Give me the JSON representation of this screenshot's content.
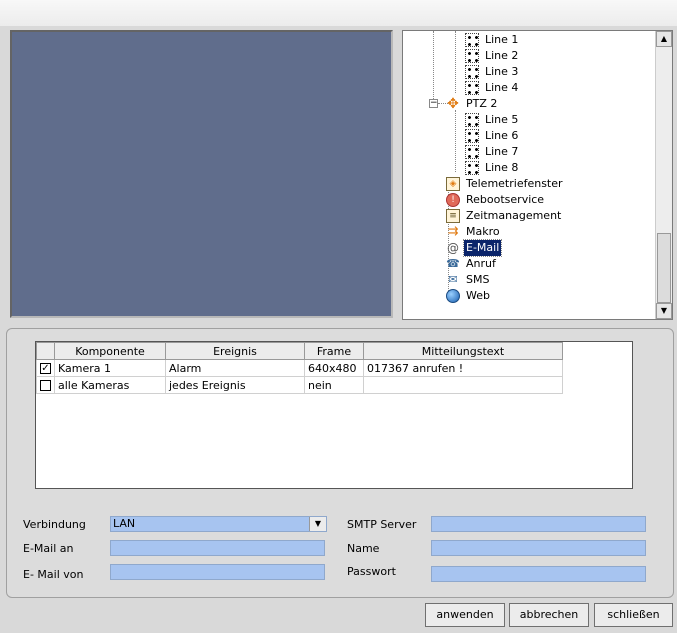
{
  "tree": {
    "items": [
      {
        "label": "Line 1",
        "icon": "line-icon"
      },
      {
        "label": "Line 2",
        "icon": "line-icon"
      },
      {
        "label": "Line 3",
        "icon": "line-icon"
      },
      {
        "label": "Line 4",
        "icon": "line-icon"
      },
      {
        "label": "PTZ 2",
        "icon": "ptz-icon"
      },
      {
        "label": "Line 5",
        "icon": "line-icon"
      },
      {
        "label": "Line 6",
        "icon": "line-icon"
      },
      {
        "label": "Line 7",
        "icon": "line-icon"
      },
      {
        "label": "Line 8",
        "icon": "line-icon"
      },
      {
        "label": "Telemetriefenster",
        "icon": "telemetry-icon"
      },
      {
        "label": "Rebootservice",
        "icon": "reboot-icon"
      },
      {
        "label": "Zeitmanagement",
        "icon": "calendar-icon"
      },
      {
        "label": "Makro",
        "icon": "macro-icon"
      },
      {
        "label": "E-Mail",
        "icon": "email-icon",
        "selected": true
      },
      {
        "label": "Anruf",
        "icon": "phone-icon"
      },
      {
        "label": "SMS",
        "icon": "sms-icon"
      },
      {
        "label": "Web",
        "icon": "globe-icon"
      }
    ]
  },
  "table": {
    "headers": [
      "Komponente",
      "Ereignis",
      "Frame",
      "Mitteilungstext"
    ],
    "rows": [
      {
        "checked": true,
        "komponente": "Kamera 1",
        "ereignis": "Alarm",
        "frame": "640x480",
        "text": "017367 anrufen !"
      },
      {
        "checked": false,
        "komponente": "alle Kameras",
        "ereignis": "jedes Ereignis",
        "frame": "nein",
        "text": ""
      }
    ]
  },
  "form": {
    "verbindung_label": "Verbindung",
    "verbindung_value": "LAN",
    "email_an_label": "E-Mail an",
    "email_an_value": "",
    "email_von_label": "E- Mail von",
    "email_von_value": "",
    "smtp_label": "SMTP Server",
    "smtp_value": "",
    "name_label": "Name",
    "name_value": "",
    "passwort_label": "Passwort",
    "passwort_value": ""
  },
  "buttons": {
    "apply": "anwenden",
    "cancel": "abbrechen",
    "close": "schließen"
  },
  "colors": {
    "video_bg": "#606d8c",
    "field_bg": "#a7c4f0",
    "selection": "#0a246a"
  }
}
